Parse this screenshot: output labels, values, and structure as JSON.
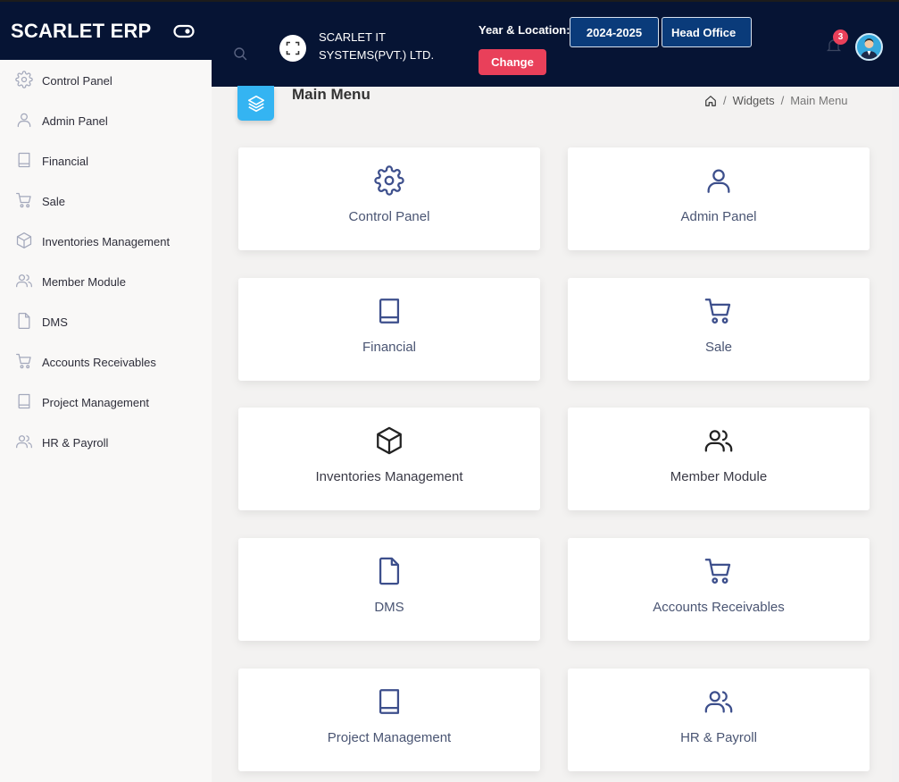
{
  "header": {
    "brand": "SCARLET ERP",
    "company": "SCARLET IT SYSTEMS(PVT.) LTD.",
    "year_location_label": "Year & Location:",
    "year": "2024-2025",
    "location": "Head Office",
    "change_label": "Change",
    "notification_count": "3"
  },
  "sidebar": {
    "items": [
      {
        "label": "Control Panel",
        "icon": "gear-icon"
      },
      {
        "label": "Admin Panel",
        "icon": "user-icon"
      },
      {
        "label": "Financial",
        "icon": "book-icon"
      },
      {
        "label": "Sale",
        "icon": "cart-icon"
      },
      {
        "label": "Inventories Management",
        "icon": "box-icon"
      },
      {
        "label": "Member Module",
        "icon": "users-icon"
      },
      {
        "label": "DMS",
        "icon": "file-icon"
      },
      {
        "label": "Accounts Receivables",
        "icon": "cart-icon"
      },
      {
        "label": "Project Management",
        "icon": "book-icon"
      },
      {
        "label": "HR & Payroll",
        "icon": "users-icon"
      }
    ]
  },
  "main": {
    "title": "Main Menu",
    "breadcrumb": [
      "Widgets",
      "Main Menu"
    ],
    "cards": [
      {
        "label": "Control Panel",
        "icon": "gear-icon"
      },
      {
        "label": "Admin Panel",
        "icon": "user-icon"
      },
      {
        "label": "Financial",
        "icon": "book-icon"
      },
      {
        "label": "Sale",
        "icon": "cart-icon"
      },
      {
        "label": "Inventories Management",
        "icon": "box-icon"
      },
      {
        "label": "Member Module",
        "icon": "users-icon"
      },
      {
        "label": "DMS",
        "icon": "file-icon"
      },
      {
        "label": "Accounts Receivables",
        "icon": "cart-icon"
      },
      {
        "label": "Project Management",
        "icon": "book-icon"
      },
      {
        "label": "HR & Payroll",
        "icon": "users-icon"
      }
    ]
  },
  "colors": {
    "header_bg": "#061434",
    "accent_blue": "#0a3b7a",
    "change_red": "#e9405a",
    "page_icon_blue": "#34b4f2",
    "card_icon_blue": "#3d4f8c",
    "sidebar_icon_gray": "#a3a8bb"
  }
}
